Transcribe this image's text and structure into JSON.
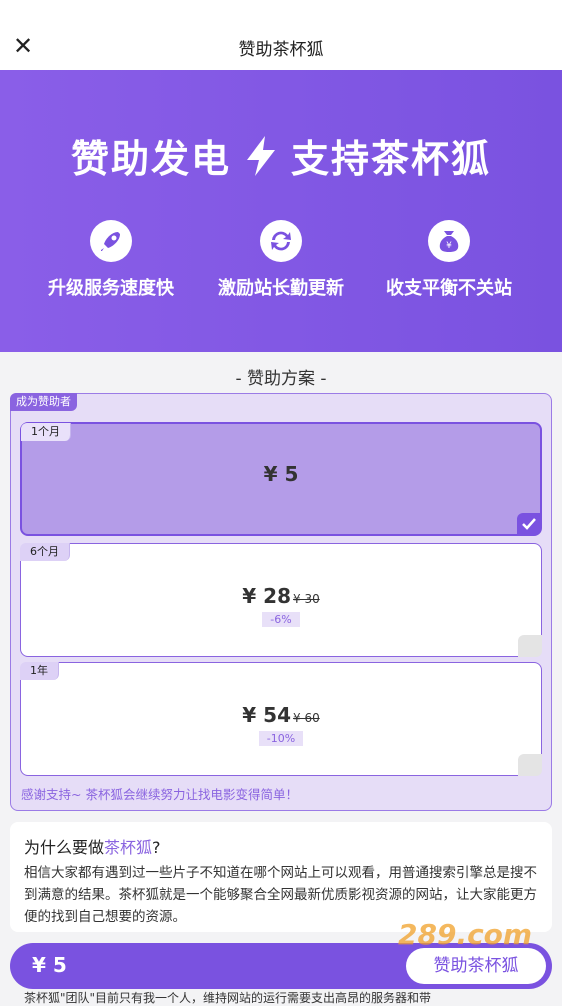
{
  "nav": {
    "title": "赞助茶杯狐"
  },
  "hero": {
    "title_left": "赞助发电",
    "title_right": "支持茶杯狐",
    "features": [
      {
        "icon": "rocket-icon",
        "label": "升级服务速度快"
      },
      {
        "icon": "refresh-icon",
        "label": "激励站长勤更新"
      },
      {
        "icon": "money-bag-icon",
        "label": "收支平衡不关站"
      }
    ]
  },
  "plans_section": {
    "title": "- 赞助方案 -",
    "tag": "成为赞助者",
    "plans": [
      {
        "period": "1个月",
        "price": "¥ 5",
        "old_price": "",
        "discount": "",
        "selected": true
      },
      {
        "period": "6个月",
        "price": "¥ 28",
        "old_price": "¥ 30",
        "discount": "-6%",
        "selected": false
      },
      {
        "period": "1年",
        "price": "¥ 54",
        "old_price": "¥ 60",
        "discount": "-10%",
        "selected": false
      }
    ],
    "thanks": "感谢支持~ 茶杯狐会继续努力让找电影变得简单！"
  },
  "why": {
    "title_prefix": "为什么要做",
    "title_highlight": "茶杯狐",
    "title_suffix": "?",
    "body": "相信大家都有遇到过一些片子不知道在哪个网站上可以观看，用普通搜索引擎总是搜不到满意的结果。茶杯狐就是一个能够聚合全网最新优质影视资源的网站，让大家能更方便的找到自己想要的资源。"
  },
  "bottom": {
    "price": "¥ 5",
    "button": "赞助茶杯狐",
    "footer": "茶杯狐\"团队\"目前只有我一个人，维持网站的运行需要支出高昂的服务器和带"
  },
  "watermark": "289.com",
  "colors": {
    "accent": "#7a52e0",
    "accent_light": "#e6ddf7"
  }
}
